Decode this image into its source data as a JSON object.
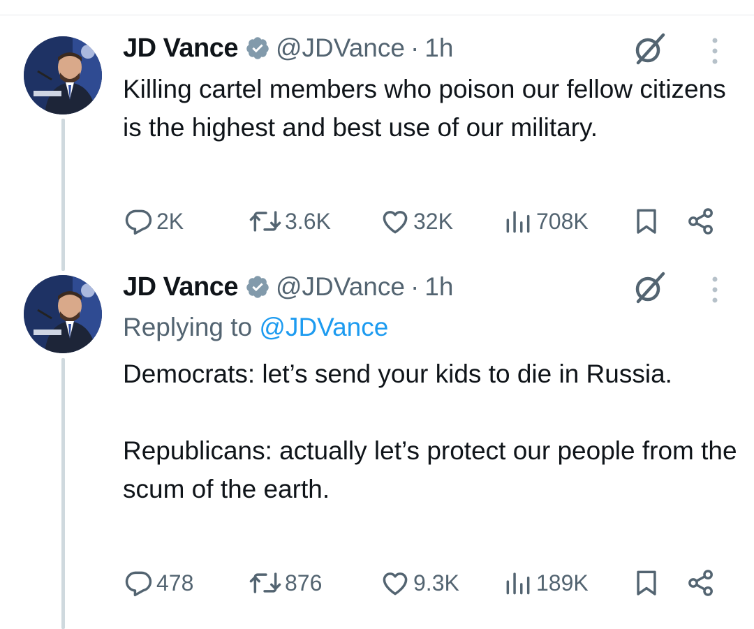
{
  "tweets": [
    {
      "author": {
        "name": "JD Vance",
        "handle": "@JDVance",
        "time": "1h"
      },
      "reply_to": null,
      "text": "Killing cartel members who poison our fellow citizens is the highest and best use of our military.",
      "stats": {
        "replies": "2K",
        "reposts": "3.6K",
        "likes": "32K",
        "views": "708K"
      }
    },
    {
      "author": {
        "name": "JD Vance",
        "handle": "@JDVance",
        "time": "1h"
      },
      "reply_to": {
        "label": "Replying to",
        "mention": "@JDVance"
      },
      "text": "Democrats: let’s send your kids to die in Russia.\n\nRepublicans: actually let’s protect our people from the scum of the earth.",
      "stats": {
        "replies": "478",
        "reposts": "876",
        "likes": "9.3K",
        "views": "189K"
      }
    }
  ],
  "separator": "·",
  "icons": {
    "verified": "verified-badge-icon",
    "grok": "grok-icon",
    "more": "more-icon",
    "reply": "reply-icon",
    "repost": "repost-icon",
    "like": "like-icon",
    "views": "views-icon",
    "bookmark": "bookmark-icon",
    "share": "share-icon"
  },
  "colors": {
    "text": "#0f1419",
    "secondary": "#536471",
    "link": "#1d9bf0",
    "thread_line": "#cfd9de"
  }
}
